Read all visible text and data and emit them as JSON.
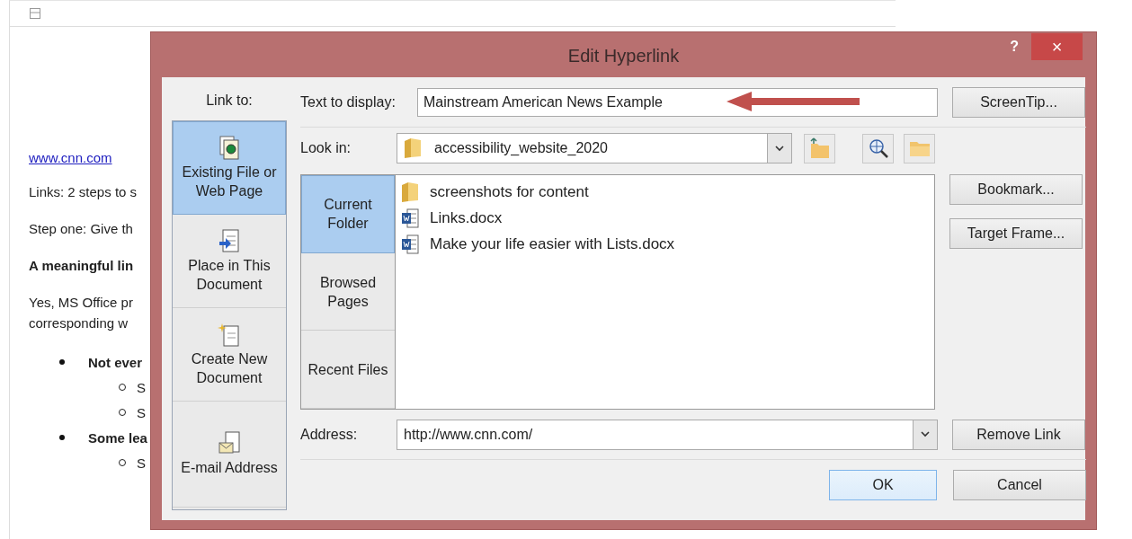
{
  "document": {
    "link": "www.cnn.com",
    "paragraphs": [
      {
        "lines": [
          "Links: 2 steps to s"
        ],
        "bold": false
      },
      {
        "lines": [
          "Step one: Give th"
        ],
        "bold": false
      },
      {
        "lines": [
          "A meaningful lin"
        ],
        "bold": true
      },
      {
        "lines": [
          "Yes, MS Office pr",
          "corresponding w"
        ],
        "bold": false
      }
    ],
    "bullets": [
      {
        "text": "Not ever",
        "children": [
          {
            "text": "S"
          },
          {
            "text": "S"
          }
        ]
      },
      {
        "text": "Some lea",
        "children": [
          {
            "text": "S"
          }
        ]
      }
    ]
  },
  "dialog": {
    "title": "Edit Hyperlink",
    "help": "?",
    "close": "×",
    "link_to_label": "Link to:",
    "link_to": [
      {
        "label": "Existing File or Web Page",
        "selected": true
      },
      {
        "label": "Place in This Document",
        "selected": false
      },
      {
        "label": "Create New Document",
        "selected": false
      },
      {
        "label": "E-mail Address",
        "selected": false
      }
    ],
    "text_to_display": {
      "label": "Text to display:",
      "value": "Mainstream American News Example"
    },
    "look_in": {
      "label": "Look in:",
      "value": "accessibility_website_2020"
    },
    "browse_tabs": [
      {
        "label": "Current Folder",
        "selected": true
      },
      {
        "label": "Browsed Pages",
        "selected": false
      },
      {
        "label": "Recent Files",
        "selected": false
      }
    ],
    "files": [
      {
        "name": "screenshots for content",
        "kind": "folder"
      },
      {
        "name": "Links.docx",
        "kind": "doc"
      },
      {
        "name": "Make your life easier with Lists.docx",
        "kind": "doc"
      }
    ],
    "address": {
      "label": "Address:",
      "value": "http://www.cnn.com/"
    },
    "side_buttons": [
      "ScreenTip...",
      "Bookmark...",
      "Target Frame...",
      "Remove Link"
    ],
    "ok": "OK",
    "cancel": "Cancel"
  }
}
